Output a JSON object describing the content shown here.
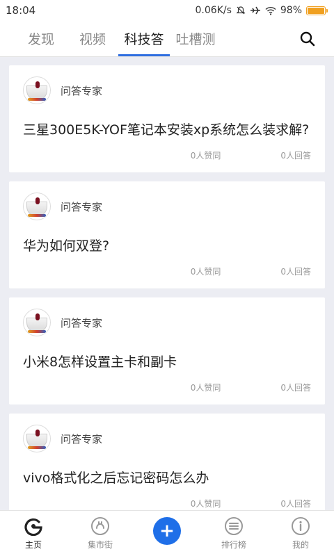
{
  "status_bar": {
    "time": "18:04",
    "speed": "0.06K/s",
    "battery": "98%",
    "battery_level": 0.98
  },
  "top_tabs": [
    {
      "label": "发现",
      "active": false
    },
    {
      "label": "视频",
      "active": false
    },
    {
      "label": "科技答",
      "active": true
    },
    {
      "label": "吐槽测",
      "active": false
    }
  ],
  "feed": [
    {
      "author": "问答专家",
      "question": "三星300E5K-YOF笔记本安装xp系统怎么装求解?",
      "likes": "0人赞同",
      "answers": "0人回答"
    },
    {
      "author": "问答专家",
      "question": "华为如何双登?",
      "likes": "0人赞同",
      "answers": "0人回答"
    },
    {
      "author": "问答专家",
      "question": "小米8怎样设置主卡和副卡",
      "likes": "0人赞同",
      "answers": "0人回答"
    },
    {
      "author": "问答专家",
      "question": "vivo格式化之后忘记密码怎么办",
      "likes": "0人赞同",
      "answers": "0人回答"
    }
  ],
  "bottom_nav": [
    {
      "label": "主页",
      "icon": "home-g-icon",
      "active": true
    },
    {
      "label": "集市街",
      "icon": "market-icon",
      "active": false
    },
    {
      "label": "+",
      "icon": "plus-icon",
      "active": false
    },
    {
      "label": "排行榜",
      "icon": "ranking-icon",
      "active": false
    },
    {
      "label": "我的",
      "icon": "info-icon",
      "active": false
    }
  ],
  "colors": {
    "accent": "#2f6fe0",
    "fab": "#1f6fe8",
    "battery": "#f0a020",
    "background": "#ecedf3"
  }
}
